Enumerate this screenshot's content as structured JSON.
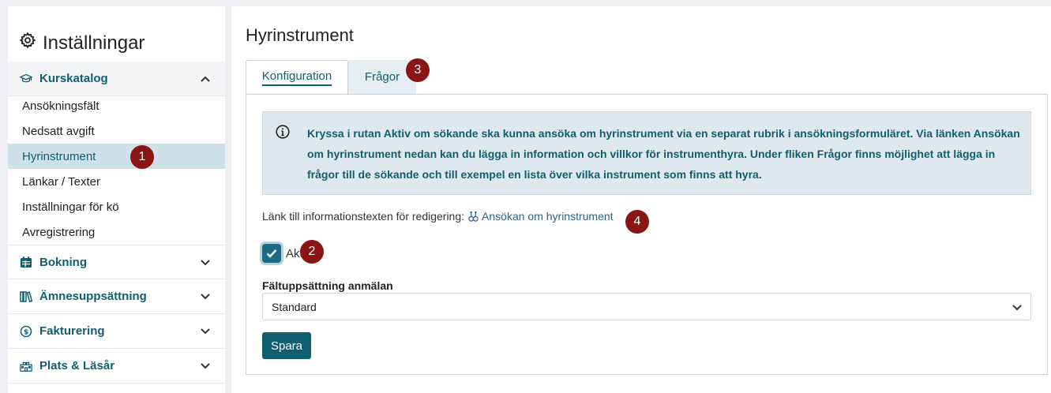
{
  "sidebar": {
    "title": "Inställningar",
    "title_icon": "gear-icon",
    "sections": [
      {
        "label": "Kurskatalog",
        "icon": "graduation-cap-icon",
        "expanded": true
      },
      {
        "label": "Bokning",
        "icon": "calendar-icon",
        "expanded": false
      },
      {
        "label": "Ämnesuppsättning",
        "icon": "books-icon",
        "expanded": false
      },
      {
        "label": "Fakturering",
        "icon": "dollar-circle-icon",
        "expanded": false
      },
      {
        "label": "Plats & Läsår",
        "icon": "school-building-icon",
        "expanded": false
      }
    ],
    "kurskatalog_items": [
      {
        "label": "Ansökningsfält"
      },
      {
        "label": "Nedsatt avgift"
      },
      {
        "label": "Hyrinstrument",
        "active": true
      },
      {
        "label": "Länkar / Texter"
      },
      {
        "label": "Inställningar för kö"
      },
      {
        "label": "Avregistrering"
      }
    ]
  },
  "main": {
    "title": "Hyrinstrument",
    "tabs": [
      {
        "label": "Konfiguration",
        "active": true
      },
      {
        "label": "Frågor",
        "active": false
      }
    ],
    "info_text": "Kryssa i rutan Aktiv om sökande ska kunna ansöka om hyrinstrument via en separat rubrik i ansökningsformuläret. Via länken Ansökan om hyrinstrument nedan kan du lägga in information och villkor för instrumenthyra. Under fliken Frågor finns möjlighet att lägga in frågor till de sökande och till exempel en lista över vilka instrument som finns att hyra.",
    "link_prefix": "Länk till informationstexten för redigering:",
    "link_label": "Ansökan om hyrinstrument",
    "checkbox_label": "Aktiv",
    "checkbox_checked": true,
    "select_label": "Fältuppsättning anmälan",
    "select_value": "Standard",
    "save_label": "Spara"
  },
  "annotations": [
    "1",
    "2",
    "3",
    "4"
  ],
  "colors": {
    "accent": "#0f5f70",
    "badge": "#8b1414",
    "active_item_bg": "#cfe1e8",
    "info_bg": "#dfe8ec",
    "link": "#2d6287"
  }
}
